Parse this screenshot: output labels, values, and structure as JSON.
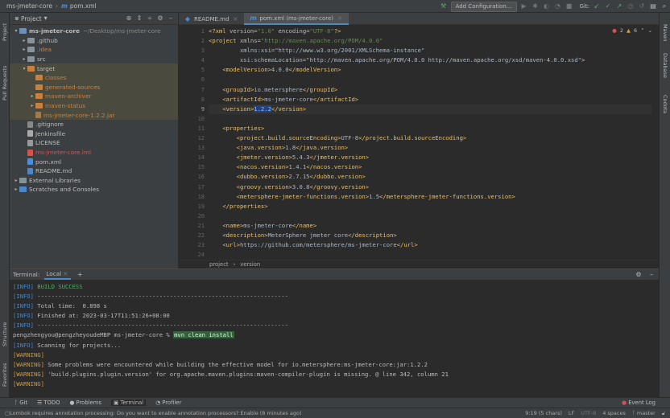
{
  "titlebar": {
    "project": "ms-jmeter-core",
    "file_prefix": "m",
    "file": "pom.xml",
    "run_config": "Add Configuration...",
    "git_label": "Git:"
  },
  "left_strip": [
    "Project",
    "Pull Requests",
    "Structure",
    "Favorites"
  ],
  "right_strip": [
    "Maven",
    "Database",
    "Codota"
  ],
  "project_panel": {
    "title": "Project",
    "tree": [
      {
        "indent": 0,
        "arrow": "▾",
        "icon": "folder-module",
        "label": "ms-jmeter-core",
        "hint": "~/Desktop/ms-jmeter-core",
        "color": "#bbbbbb",
        "bold": true
      },
      {
        "indent": 1,
        "arrow": "▸",
        "icon": "folder",
        "label": ".github",
        "color": "#bbbbbb"
      },
      {
        "indent": 1,
        "arrow": "▸",
        "icon": "folder",
        "label": ".idea",
        "color": "#c7813f"
      },
      {
        "indent": 1,
        "arrow": "▸",
        "icon": "folder",
        "label": "src",
        "color": "#bbbbbb"
      },
      {
        "indent": 1,
        "arrow": "▾",
        "icon": "folder-orange",
        "label": "target",
        "color": "#bbbbbb",
        "sel": true
      },
      {
        "indent": 2,
        "arrow": "",
        "icon": "folder-orange",
        "label": "classes",
        "color": "#c7813f",
        "sel": true
      },
      {
        "indent": 2,
        "arrow": "",
        "icon": "folder-orange",
        "label": "generated-sources",
        "color": "#c7813f",
        "sel": true
      },
      {
        "indent": 2,
        "arrow": "▸",
        "icon": "folder-orange",
        "label": "maven-archiver",
        "color": "#c7813f",
        "sel": true
      },
      {
        "indent": 2,
        "arrow": "▸",
        "icon": "folder-orange",
        "label": "maven-status",
        "color": "#c7813f",
        "sel": true
      },
      {
        "indent": 2,
        "arrow": "",
        "icon": "jar",
        "label": "ms-jmeter-core-1.2.2.jar",
        "color": "#c7813f",
        "sel": true
      },
      {
        "indent": 1,
        "arrow": "",
        "icon": "gitignore",
        "label": ".gitignore",
        "color": "#bbbbbb"
      },
      {
        "indent": 1,
        "arrow": "",
        "icon": "jenkins",
        "label": "Jenkinsfile",
        "color": "#bbbbbb"
      },
      {
        "indent": 1,
        "arrow": "",
        "icon": "text-file",
        "label": "LICENSE",
        "color": "#bbbbbb"
      },
      {
        "indent": 1,
        "arrow": "",
        "icon": "iml-file",
        "label": "ms-jmeter-core.iml",
        "color": "#d25252"
      },
      {
        "indent": 1,
        "arrow": "",
        "icon": "maven-file",
        "label": "pom.xml",
        "color": "#bbbbbb"
      },
      {
        "indent": 1,
        "arrow": "",
        "icon": "markdown-file",
        "label": "README.md",
        "color": "#bbbbbb"
      },
      {
        "indent": 0,
        "arrow": "▸",
        "icon": "libraries",
        "label": "External Libraries",
        "color": "#bbbbbb"
      },
      {
        "indent": 0,
        "arrow": "▸",
        "icon": "scratches",
        "label": "Scratches and Consoles",
        "color": "#bbbbbb"
      }
    ]
  },
  "editor": {
    "tabs": [
      {
        "label": "README.md",
        "active": false
      },
      {
        "label": "pom.xml (ms-jmeter-core)",
        "active": true
      }
    ],
    "inspections": {
      "errors": "2",
      "warnings": "6"
    },
    "breadcrumb": [
      "project",
      "version"
    ],
    "line_numbers": [
      "1",
      "2",
      "3",
      "4",
      "5",
      "6",
      "7",
      "8",
      "9",
      "10",
      "11",
      "12",
      "13",
      "14",
      "15",
      "16",
      "17",
      "18",
      "19",
      "20",
      "21",
      "22",
      "23",
      "24"
    ],
    "lines": [
      "<?xml version=\"1.0\" encoding=\"UTF-8\"?>",
      "<project xmlns=\"http://maven.apache.org/POM/4.0.0\"",
      "         xmlns:xsi=\"http://www.w3.org/2001/XMLSchema-instance\"",
      "         xsi:schemaLocation=\"http://maven.apache.org/POM/4.0.0 http://maven.apache.org/xsd/maven-4.0.0.xsd\">",
      "    <modelVersion>4.0.0</modelVersion>",
      "",
      "    <groupId>io.metersphere</groupId>",
      "    <artifactId>ms-jmeter-core</artifactId>",
      "    <version>1.2.2</version>",
      "",
      "    <properties>",
      "        <project.build.sourceEncoding>UTF-8</project.build.sourceEncoding>",
      "        <java.version>1.8</java.version>",
      "        <jmeter.version>5.4.3</jmeter.version>",
      "        <nacos.version>1.4.1</nacos.version>",
      "        <dubbo.version>2.7.15</dubbo.version>",
      "        <groovy.version>3.0.8</groovy.version>",
      "        <metersphere-jmeter-functions.version>1.5</metersphere-jmeter-functions.version>",
      "    </properties>",
      "",
      "    <name>ms-jmeter-core</name>",
      "    <description>MeterSphere jmeter core</description>",
      "    <url>https://github.com/metersphere/ms-jmeter-core</url>",
      ""
    ]
  },
  "terminal": {
    "title": "Terminal:",
    "tab": "Local",
    "lines": [
      {
        "tag": "[INFO]",
        "text": " BUILD SUCCESS",
        "kind": "success"
      },
      {
        "tag": "[INFO]",
        "text": " ------------------------------------------------------------------------",
        "kind": "info"
      },
      {
        "tag": "[INFO]",
        "text": " Total time:  0.898 s",
        "kind": "info"
      },
      {
        "tag": "[INFO]",
        "text": " Finished at: 2023-03-17T11:51:26+08:00",
        "kind": "info"
      },
      {
        "tag": "[INFO]",
        "text": " ------------------------------------------------------------------------",
        "kind": "info"
      },
      {
        "tag": "",
        "text": "pengzhengyou@pengzheyoudeMBP ms-jmeter-core % ",
        "cmd": "mvn clean install",
        "kind": "prompt"
      },
      {
        "tag": "[INFO]",
        "text": " Scanning for projects...",
        "kind": "info"
      },
      {
        "tag": "[WARNING]",
        "text": "",
        "kind": "warn"
      },
      {
        "tag": "[WARNING]",
        "text": " Some problems were encountered while building the effective model for io.metersphere:ms-jmeter-core:jar:1.2.2",
        "kind": "warn"
      },
      {
        "tag": "[WARNING]",
        "text": " 'build.plugins.plugin.version' for org.apache.maven.plugins:maven-compiler-plugin is missing. @ line 342, column 21",
        "kind": "warn"
      },
      {
        "tag": "[WARNING]",
        "text": "",
        "kind": "warn"
      }
    ]
  },
  "bottom_tabs": [
    "Git",
    "TODO",
    "Problems",
    "Terminal",
    "Profiler"
  ],
  "event_log": "Event Log",
  "status": {
    "message": "Lombok requires annotation processing: Do you want to enable annotation processors? Enable (8 minutes ago)",
    "position": "9:19 (5 chars)",
    "line_sep": "LF",
    "encoding": "UTF-8",
    "indent": "4 spaces",
    "branch": "master"
  }
}
